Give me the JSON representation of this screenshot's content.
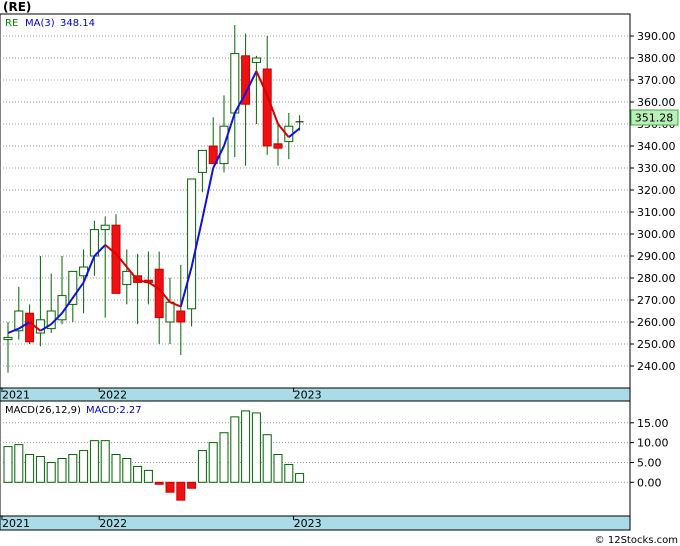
{
  "ticker_title": "(RE)",
  "credit": "© 12Stocks.com",
  "chart_data": [
    {
      "type": "candlestick",
      "legend": {
        "symbol": "RE",
        "ma_label": "MA(3)",
        "ma_value": "348.14"
      },
      "last_price_label": "351.28",
      "ylim": [
        230,
        400
      ],
      "y_ticks": [
        240,
        250,
        260,
        270,
        280,
        290,
        300,
        310,
        320,
        330,
        340,
        350,
        360,
        370,
        380,
        390
      ],
      "y_tick_labels": [
        "240.00",
        "250.00",
        "260.00",
        "270.00",
        "280.00",
        "290.00",
        "300.00",
        "310.00",
        "320.00",
        "330.00",
        "340.00",
        "350.00",
        "360.00",
        "370.00",
        "380.00",
        "390.00"
      ],
      "x_labels": [
        {
          "label": "2021",
          "index": 0
        },
        {
          "label": "2022",
          "index": 9
        },
        {
          "label": "2023",
          "index": 27
        }
      ],
      "candles": [
        {
          "o": 252,
          "h": 260,
          "l": 237,
          "c": 253
        },
        {
          "o": 256,
          "h": 276,
          "l": 252,
          "c": 265
        },
        {
          "o": 264,
          "h": 268,
          "l": 250,
          "c": 251
        },
        {
          "o": 255,
          "h": 290,
          "l": 249,
          "c": 261
        },
        {
          "o": 257,
          "h": 282,
          "l": 255,
          "c": 265
        },
        {
          "o": 261,
          "h": 290,
          "l": 259,
          "c": 272
        },
        {
          "o": 268,
          "h": 282,
          "l": 260,
          "c": 283
        },
        {
          "o": 281,
          "h": 293,
          "l": 264,
          "c": 285
        },
        {
          "o": 290,
          "h": 306,
          "l": 281,
          "c": 302
        },
        {
          "o": 302,
          "h": 308,
          "l": 262,
          "c": 304
        },
        {
          "o": 304,
          "h": 309,
          "l": 288,
          "c": 273
        },
        {
          "o": 277,
          "h": 293,
          "l": 268,
          "c": 283
        },
        {
          "o": 281,
          "h": 291,
          "l": 259,
          "c": 278
        },
        {
          "o": 279,
          "h": 292,
          "l": 268,
          "c": 278
        },
        {
          "o": 284,
          "h": 292,
          "l": 250,
          "c": 262
        },
        {
          "o": 260,
          "h": 280,
          "l": 250,
          "c": 269
        },
        {
          "o": 265,
          "h": 286,
          "l": 245,
          "c": 260
        },
        {
          "o": 266,
          "h": 311,
          "l": 258,
          "c": 325
        },
        {
          "o": 328,
          "h": 338,
          "l": 319,
          "c": 338
        },
        {
          "o": 340,
          "h": 353,
          "l": 333,
          "c": 332
        },
        {
          "o": 332,
          "h": 363,
          "l": 328,
          "c": 349
        },
        {
          "o": 355,
          "h": 395,
          "l": 335,
          "c": 382
        },
        {
          "o": 381,
          "h": 391,
          "l": 331,
          "c": 359
        },
        {
          "o": 378,
          "h": 381,
          "l": 350,
          "c": 380
        },
        {
          "o": 375,
          "h": 390,
          "l": 336,
          "c": 340
        },
        {
          "o": 341,
          "h": 351,
          "l": 331,
          "c": 339
        },
        {
          "o": 342,
          "h": 355,
          "l": 334,
          "c": 349
        },
        {
          "o": 349,
          "h": 354,
          "l": 347,
          "c": 351
        }
      ],
      "ma3": [
        255,
        257,
        260,
        256,
        259,
        264,
        271,
        278,
        290,
        295,
        291,
        285,
        279,
        278,
        275,
        269,
        267,
        285,
        307,
        330,
        340,
        355,
        364,
        374,
        363,
        350,
        344,
        348
      ]
    },
    {
      "type": "bar",
      "legend": {
        "label": "MACD(26,12,9)",
        "value_label": "MACD:2.27"
      },
      "ylim": [
        -8.5,
        20.5
      ],
      "y_ticks": [
        0,
        5,
        10,
        15
      ],
      "y_tick_labels": [
        "0.00",
        "5.00",
        "10.00",
        "15.00"
      ],
      "x_labels": [
        {
          "label": "2021",
          "index": 0
        },
        {
          "label": "2022",
          "index": 9
        },
        {
          "label": "2023",
          "index": 27
        }
      ],
      "values": [
        9,
        9.5,
        7,
        6.5,
        5,
        6,
        7,
        8,
        10.5,
        10.5,
        7,
        6,
        4,
        3,
        -0.5,
        -2.5,
        -4.5,
        -1.5,
        8,
        10,
        12.5,
        16.5,
        18,
        17.5,
        12,
        7,
        4.5,
        2.2
      ]
    }
  ]
}
